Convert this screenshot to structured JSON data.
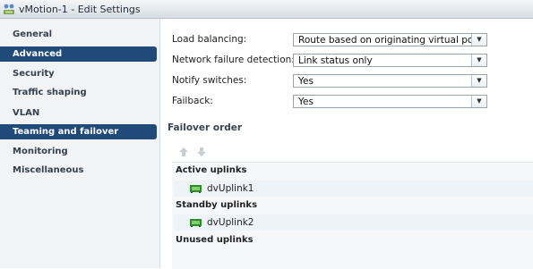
{
  "window": {
    "title": "vMotion-1 - Edit Settings",
    "title_icon": "network-portgroup-icon"
  },
  "sidebar": {
    "items": [
      {
        "label": "General",
        "active": false
      },
      {
        "label": "Advanced",
        "active": true
      },
      {
        "label": "Security",
        "active": false
      },
      {
        "label": "Traffic shaping",
        "active": false
      },
      {
        "label": "VLAN",
        "active": false
      },
      {
        "label": "Teaming and failover",
        "active": true
      },
      {
        "label": "Monitoring",
        "active": false
      },
      {
        "label": "Miscellaneous",
        "active": false
      }
    ],
    "active_color": "#1f4a7a"
  },
  "form": {
    "load_balancing": {
      "label": "Load balancing:",
      "value": "Route based on originating virtual port"
    },
    "network_failure_detection": {
      "label": "Network failure detection:",
      "value": "Link status only"
    },
    "notify_switches": {
      "label": "Notify switches:",
      "value": "Yes"
    },
    "failback": {
      "label": "Failback:",
      "value": "Yes"
    }
  },
  "failover": {
    "title": "Failover order",
    "move_up_icon": "arrow-up-icon",
    "move_down_icon": "arrow-down-icon",
    "groups": {
      "active": {
        "label": "Active uplinks",
        "uplinks": [
          "dvUplink1"
        ]
      },
      "standby": {
        "label": "Standby uplinks",
        "uplinks": [
          "dvUplink2"
        ]
      },
      "unused": {
        "label": "Unused uplinks",
        "uplinks": []
      }
    },
    "uplink_icon": "uplink-nic-icon"
  }
}
